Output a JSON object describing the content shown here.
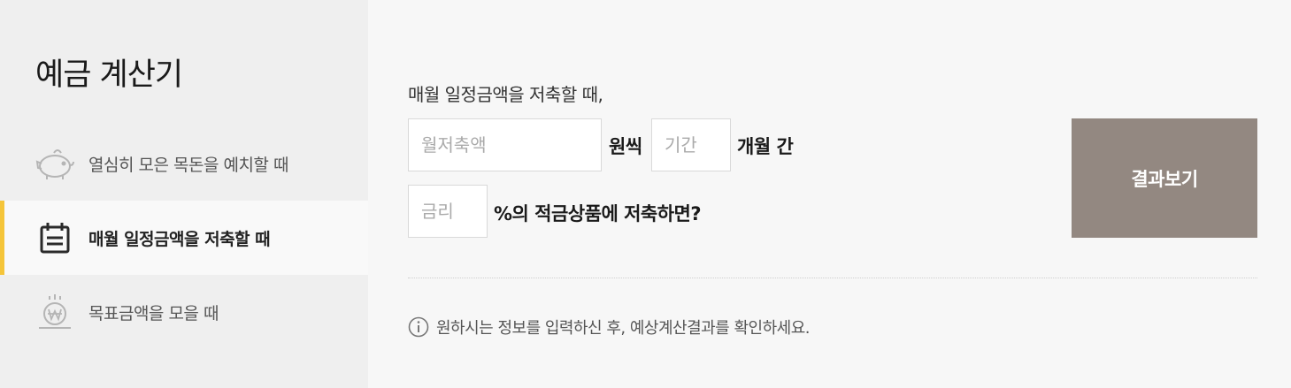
{
  "sidebar": {
    "title": "예금 계산기",
    "items": [
      {
        "label": "열심히 모은 목돈을 예치할 때",
        "icon": "piggy-bank-icon",
        "active": false
      },
      {
        "label": "매월 일정금액을 저축할 때",
        "icon": "calendar-icon",
        "active": true
      },
      {
        "label": "목표금액을 모을 때",
        "icon": "won-coin-icon",
        "active": false
      }
    ]
  },
  "form": {
    "question": "매월 일정금액을 저축할 때,",
    "monthly_placeholder": "월저축액",
    "monthly_unit": "원씩",
    "period_placeholder": "기간",
    "period_unit": "개월 간",
    "rate_placeholder": "금리",
    "rate_unit": "%의 적금상품에 저축하면?",
    "result_button": "결과보기"
  },
  "notice": {
    "icon": "info-icon",
    "text": "원하시는 정보를 입력하신 후, 예상계산결과를 확인하세요."
  },
  "colors": {
    "sidebar_bg": "#efefef",
    "active_accent": "#f5c53a",
    "button_bg": "#938881"
  }
}
